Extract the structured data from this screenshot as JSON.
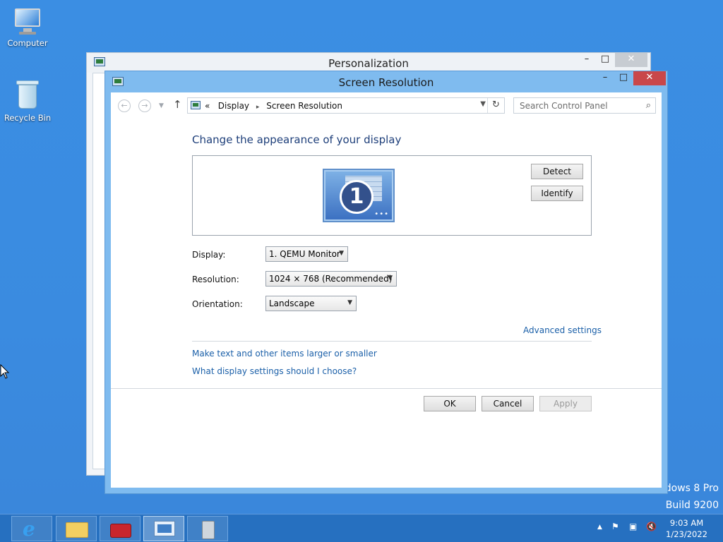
{
  "desktop": {
    "icons": [
      {
        "label": "Computer"
      },
      {
        "label": "Recycle Bin"
      }
    ],
    "watermark_line1": "dows 8 Pro",
    "watermark_line2": "Build 9200"
  },
  "back_window": {
    "title": "Personalization",
    "controls": {
      "minimize": "–",
      "maximize": "□",
      "close": "✕"
    }
  },
  "window": {
    "title": "Screen Resolution",
    "controls": {
      "minimize": "–",
      "maximize": "□",
      "close": "✕"
    },
    "address": {
      "prefix": "«",
      "crumbs": [
        "Display",
        "Screen Resolution"
      ],
      "separator": "▸"
    },
    "search": {
      "placeholder": "Search Control Panel"
    },
    "heading": "Change the appearance of your display",
    "monitor_number": "1",
    "detect_label": "Detect",
    "identify_label": "Identify",
    "display": {
      "label": "Display:",
      "value": "1. QEMU Monitor"
    },
    "resolution": {
      "label": "Resolution:",
      "value": "1024 × 768 (Recommended)"
    },
    "orientation": {
      "label": "Orientation:",
      "value": "Landscape"
    },
    "advanced_settings": "Advanced settings",
    "link_text_size": "Make text and other items larger or smaller",
    "link_display_help": "What display settings should I choose?",
    "ok_label": "OK",
    "cancel_label": "Cancel",
    "apply_label": "Apply"
  },
  "taskbar": {
    "items": [
      "internet-explorer",
      "file-explorer",
      "toolbox",
      "control-panel",
      "device"
    ],
    "active_index": 3,
    "clock_time": "9:03 AM",
    "clock_date": "1/23/2022"
  },
  "colors": {
    "desktop": "#3a8be0",
    "taskbar": "#2670c0",
    "title_accent": "#7fbbef",
    "close_button": "#c9474a",
    "link": "#1a5fa8",
    "heading": "#1e3f7a"
  }
}
